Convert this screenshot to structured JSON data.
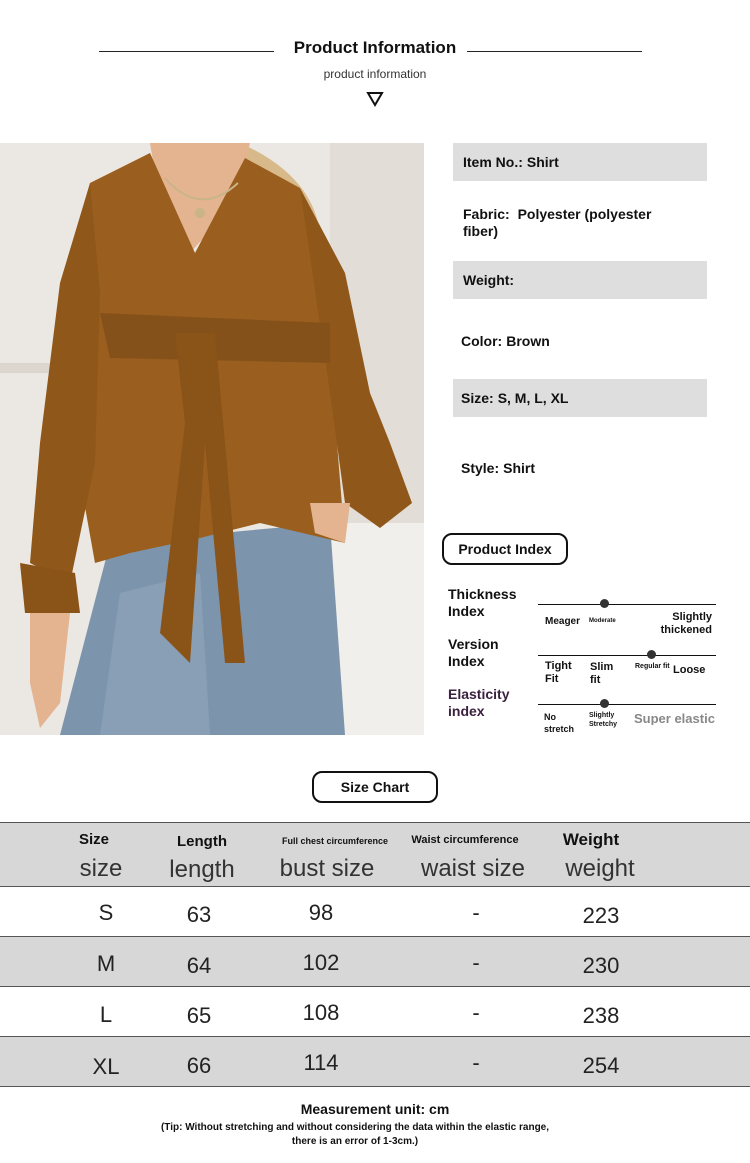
{
  "header": {
    "title": "Product Information",
    "subtitle": "product information"
  },
  "info": [
    {
      "label": "Item No.:",
      "value": "Shirt"
    },
    {
      "label": "Fabric:",
      "value": "Polyester (polyester fiber)"
    },
    {
      "label": "Weight:",
      "value": ""
    },
    {
      "label": "Color:",
      "value": "Brown"
    },
    {
      "label": "Size:",
      "value": "S, M, L, XL"
    },
    {
      "label": "Style:",
      "value": "Shirt"
    }
  ],
  "product_index": {
    "title": "Product Index",
    "thickness": {
      "name": "Thickness Index",
      "labels": [
        "Meager",
        "Moderate",
        "Slightly thickened"
      ],
      "selected": "Moderate"
    },
    "version": {
      "name": "Version Index",
      "labels": [
        "Tight Fit",
        "Slim fit",
        "Regular fit",
        "Loose"
      ],
      "selected": "Regular fit"
    },
    "elasticity": {
      "name": "Elasticity index",
      "labels": [
        "No stretch",
        "Slightly Stretchy",
        "Super elastic"
      ],
      "selected": "Slightly Stretchy"
    }
  },
  "size_chart": {
    "title": "Size Chart",
    "headers_top": [
      "Size",
      "Length",
      "Full chest circumference",
      "Waist circumference",
      "Weight"
    ],
    "headers_bottom": [
      "size",
      "length",
      "bust size",
      "waist size",
      "weight"
    ],
    "rows": [
      [
        "S",
        "63",
        "98",
        "-",
        "223"
      ],
      [
        "M",
        "64",
        "102",
        "-",
        "230"
      ],
      [
        "L",
        "65",
        "108",
        "-",
        "238"
      ],
      [
        "XL",
        "66",
        "114",
        "-",
        "254"
      ]
    ]
  },
  "footer": {
    "unit": "Measurement unit: cm",
    "tip_line1": "(Tip: Without stretching and without considering the data within the elastic range,",
    "tip_line2": "there is an error of 1-3cm.)"
  },
  "colors": {
    "shirt": "#9a5f1e",
    "jeans": "#7d94ad",
    "shade": "#dedede"
  }
}
